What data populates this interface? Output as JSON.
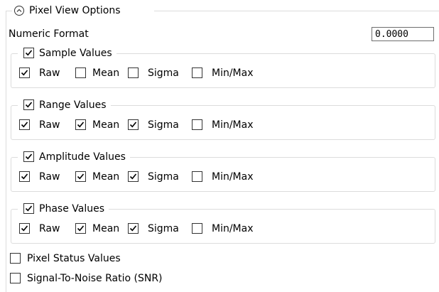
{
  "panel": {
    "title": "Pixel View Options",
    "expanded": true
  },
  "numeric_format": {
    "label": "Numeric Format",
    "value": "0.0000"
  },
  "groups": [
    {
      "label": "Sample Values",
      "checked": true,
      "options": [
        {
          "label": "Raw",
          "checked": true
        },
        {
          "label": "Mean",
          "checked": false
        },
        {
          "label": "Sigma",
          "checked": false
        },
        {
          "label": "Min/Max",
          "checked": false
        }
      ]
    },
    {
      "label": "Range Values",
      "checked": true,
      "options": [
        {
          "label": "Raw",
          "checked": true
        },
        {
          "label": "Mean",
          "checked": true
        },
        {
          "label": "Sigma",
          "checked": true
        },
        {
          "label": "Min/Max",
          "checked": false
        }
      ]
    },
    {
      "label": "Amplitude Values",
      "checked": true,
      "options": [
        {
          "label": "Raw",
          "checked": true
        },
        {
          "label": "Mean",
          "checked": true
        },
        {
          "label": "Sigma",
          "checked": true
        },
        {
          "label": "Min/Max",
          "checked": false
        }
      ]
    },
    {
      "label": "Phase Values",
      "checked": true,
      "options": [
        {
          "label": "Raw",
          "checked": true
        },
        {
          "label": "Mean",
          "checked": true
        },
        {
          "label": "Sigma",
          "checked": true
        },
        {
          "label": "Min/Max",
          "checked": false
        }
      ]
    }
  ],
  "extras": [
    {
      "label": "Pixel Status Values",
      "checked": false
    },
    {
      "label": "Signal-To-Noise Ratio (SNR)",
      "checked": false
    }
  ]
}
